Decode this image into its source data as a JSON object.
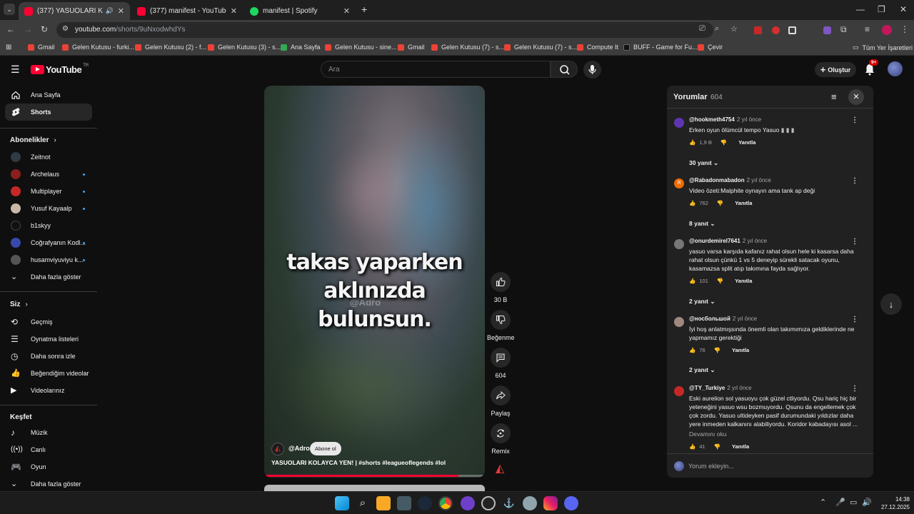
{
  "browser": {
    "tabs": [
      {
        "title": "(377) YASUOLARI KOLAYCA",
        "active": true
      },
      {
        "title": "(377) manifest - YouTube",
        "active": false
      },
      {
        "title": "manifest | Spotify",
        "active": false
      }
    ],
    "url_host": "youtube.com",
    "url_path": "/shorts/9uNxodwhdYs",
    "bookmarks": [
      "Gmail",
      "Gelen Kutusu - furki...",
      "Gelen Kutusu (2) - f...",
      "Gelen Kutusu (3) - s...",
      "Ana Sayfa",
      "Gelen Kutusu - sine...",
      "Gmail",
      "Gelen Kutusu (7) - s...",
      "Gelen Kutusu (7) - s...",
      "Compute It",
      "BUFF - Game for Fu...",
      "Çevir"
    ],
    "all_bookmarks": "Tüm Yer İşaretleri"
  },
  "youtube": {
    "logo": "YouTube",
    "logo_region": "TR",
    "search_placeholder": "Ara",
    "create_label": "Oluştur",
    "notification_count": "9+"
  },
  "guide": {
    "home": "Ana Sayfa",
    "shorts": "Shorts",
    "subscriptions_header": "Abonelikler",
    "subscriptions": [
      "Zeitnot",
      "Archelaus",
      "Multiplayer",
      "Yusuf Kayaalp",
      "b1skyy",
      "Coğrafyanın Kodl...",
      "husamviyuviyu k..."
    ],
    "show_more_1": "Daha fazla göster",
    "you_header": "Siz",
    "you_items": [
      "Geçmiş",
      "Oynatma listeleri",
      "Daha sonra izle",
      "Beğendiğim videolar",
      "Videolarınız"
    ],
    "explore_header": "Keşfet",
    "explore_items": [
      "Müzik",
      "Canlı",
      "Oyun"
    ],
    "show_more_2": "Daha fazla göster"
  },
  "video": {
    "caption_line1": "takas yaparken",
    "caption_line2": "aklınızda bulunsun.",
    "watermark": "@Adro",
    "channel": "@Adro",
    "subscribe": "Abone ol",
    "title": "YASUOLARI KOLAYCA YEN! | #shorts #leagueoflegends #lol",
    "progress": 0.88
  },
  "actions": {
    "likes": "30 B",
    "dislike": "Beğenme",
    "comments": "604",
    "share": "Paylaş",
    "remix": "Remix"
  },
  "comments": {
    "title": "Yorumlar",
    "count": "604",
    "add_placeholder": "Yorum ekleyin...",
    "reply_label": "Yanıtla",
    "read_more": "Devamını oku",
    "items": [
      {
        "user": "@hookmeth4754",
        "ago": "2 yıl önce",
        "text": "Erken oyun ölümcül tempo Yasuo",
        "likes": "1,9 B",
        "replies": "30 yanıt"
      },
      {
        "user": "@Rabadonmabadon",
        "ago": "2 yıl önce",
        "text": "Video özeti:Malphite oynayın ama tank ap deği",
        "likes": "762",
        "replies": "8 yanıt"
      },
      {
        "user": "@onurdemirel7641",
        "ago": "2 yıl önce",
        "text": "yasuo varsa karşıda kafanız rahat olsun hele ki kasarsa daha rahat olsun çünkü 1 vs 5 deneyip sürekli satacak oyunu, kasamazsa split atıp takımına fayda sağlıyor.",
        "likes": "101",
        "replies": "2 yanıt"
      },
      {
        "user": "@носбольшой",
        "ago": "2 yıl önce",
        "text": "İyi hoş anlatmışsında önemli olan takımımıza geldiklerinde ne yapmamız gerektiği",
        "likes": "76",
        "replies": "2 yanıt"
      },
      {
        "user": "@TY_Turkiye",
        "ago": "2 yıl önce",
        "text": "Eski aurelion sol yasuoyu çok güzel ctliyordu. Qsu hariç hiç bir yeteneğini yasuo wsu bozmuyordu. Qsunu da engellemek çok çok zordu. Yasuo ultideyken pasif durumundaki yıldızlar daha yere inmeden kalkanını alabiliyordu. Koridor kabadayısı asol ...",
        "likes": "41",
        "replies": ""
      }
    ]
  },
  "taskbar": {
    "time": "14:38",
    "date": "27.12.2025"
  }
}
